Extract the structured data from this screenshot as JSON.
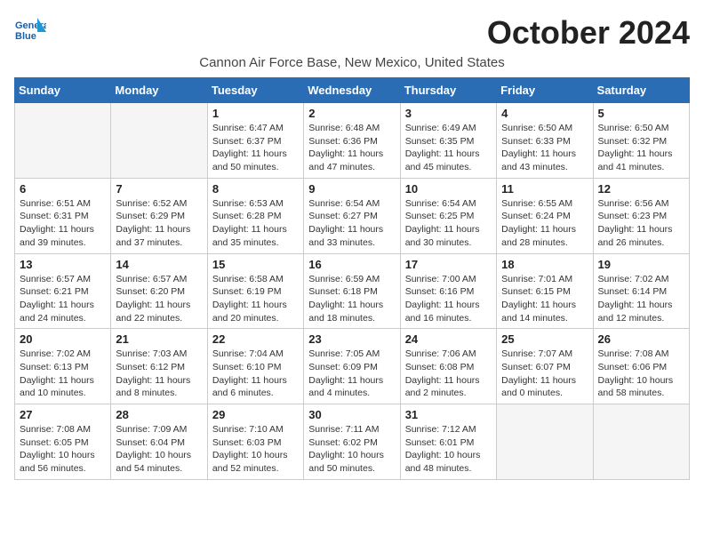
{
  "header": {
    "logo_line1": "General",
    "logo_line2": "Blue",
    "month": "October 2024",
    "location": "Cannon Air Force Base, New Mexico, United States"
  },
  "weekdays": [
    "Sunday",
    "Monday",
    "Tuesday",
    "Wednesday",
    "Thursday",
    "Friday",
    "Saturday"
  ],
  "weeks": [
    [
      {
        "day": "",
        "empty": true
      },
      {
        "day": "",
        "empty": true
      },
      {
        "day": "1",
        "sunrise": "6:47 AM",
        "sunset": "6:37 PM",
        "daylight": "11 hours and 50 minutes."
      },
      {
        "day": "2",
        "sunrise": "6:48 AM",
        "sunset": "6:36 PM",
        "daylight": "11 hours and 47 minutes."
      },
      {
        "day": "3",
        "sunrise": "6:49 AM",
        "sunset": "6:35 PM",
        "daylight": "11 hours and 45 minutes."
      },
      {
        "day": "4",
        "sunrise": "6:50 AM",
        "sunset": "6:33 PM",
        "daylight": "11 hours and 43 minutes."
      },
      {
        "day": "5",
        "sunrise": "6:50 AM",
        "sunset": "6:32 PM",
        "daylight": "11 hours and 41 minutes."
      }
    ],
    [
      {
        "day": "6",
        "sunrise": "6:51 AM",
        "sunset": "6:31 PM",
        "daylight": "11 hours and 39 minutes."
      },
      {
        "day": "7",
        "sunrise": "6:52 AM",
        "sunset": "6:29 PM",
        "daylight": "11 hours and 37 minutes."
      },
      {
        "day": "8",
        "sunrise": "6:53 AM",
        "sunset": "6:28 PM",
        "daylight": "11 hours and 35 minutes."
      },
      {
        "day": "9",
        "sunrise": "6:54 AM",
        "sunset": "6:27 PM",
        "daylight": "11 hours and 33 minutes."
      },
      {
        "day": "10",
        "sunrise": "6:54 AM",
        "sunset": "6:25 PM",
        "daylight": "11 hours and 30 minutes."
      },
      {
        "day": "11",
        "sunrise": "6:55 AM",
        "sunset": "6:24 PM",
        "daylight": "11 hours and 28 minutes."
      },
      {
        "day": "12",
        "sunrise": "6:56 AM",
        "sunset": "6:23 PM",
        "daylight": "11 hours and 26 minutes."
      }
    ],
    [
      {
        "day": "13",
        "sunrise": "6:57 AM",
        "sunset": "6:21 PM",
        "daylight": "11 hours and 24 minutes."
      },
      {
        "day": "14",
        "sunrise": "6:57 AM",
        "sunset": "6:20 PM",
        "daylight": "11 hours and 22 minutes."
      },
      {
        "day": "15",
        "sunrise": "6:58 AM",
        "sunset": "6:19 PM",
        "daylight": "11 hours and 20 minutes."
      },
      {
        "day": "16",
        "sunrise": "6:59 AM",
        "sunset": "6:18 PM",
        "daylight": "11 hours and 18 minutes."
      },
      {
        "day": "17",
        "sunrise": "7:00 AM",
        "sunset": "6:16 PM",
        "daylight": "11 hours and 16 minutes."
      },
      {
        "day": "18",
        "sunrise": "7:01 AM",
        "sunset": "6:15 PM",
        "daylight": "11 hours and 14 minutes."
      },
      {
        "day": "19",
        "sunrise": "7:02 AM",
        "sunset": "6:14 PM",
        "daylight": "11 hours and 12 minutes."
      }
    ],
    [
      {
        "day": "20",
        "sunrise": "7:02 AM",
        "sunset": "6:13 PM",
        "daylight": "11 hours and 10 minutes."
      },
      {
        "day": "21",
        "sunrise": "7:03 AM",
        "sunset": "6:12 PM",
        "daylight": "11 hours and 8 minutes."
      },
      {
        "day": "22",
        "sunrise": "7:04 AM",
        "sunset": "6:10 PM",
        "daylight": "11 hours and 6 minutes."
      },
      {
        "day": "23",
        "sunrise": "7:05 AM",
        "sunset": "6:09 PM",
        "daylight": "11 hours and 4 minutes."
      },
      {
        "day": "24",
        "sunrise": "7:06 AM",
        "sunset": "6:08 PM",
        "daylight": "11 hours and 2 minutes."
      },
      {
        "day": "25",
        "sunrise": "7:07 AM",
        "sunset": "6:07 PM",
        "daylight": "11 hours and 0 minutes."
      },
      {
        "day": "26",
        "sunrise": "7:08 AM",
        "sunset": "6:06 PM",
        "daylight": "10 hours and 58 minutes."
      }
    ],
    [
      {
        "day": "27",
        "sunrise": "7:08 AM",
        "sunset": "6:05 PM",
        "daylight": "10 hours and 56 minutes."
      },
      {
        "day": "28",
        "sunrise": "7:09 AM",
        "sunset": "6:04 PM",
        "daylight": "10 hours and 54 minutes."
      },
      {
        "day": "29",
        "sunrise": "7:10 AM",
        "sunset": "6:03 PM",
        "daylight": "10 hours and 52 minutes."
      },
      {
        "day": "30",
        "sunrise": "7:11 AM",
        "sunset": "6:02 PM",
        "daylight": "10 hours and 50 minutes."
      },
      {
        "day": "31",
        "sunrise": "7:12 AM",
        "sunset": "6:01 PM",
        "daylight": "10 hours and 48 minutes."
      },
      {
        "day": "",
        "empty": true
      },
      {
        "day": "",
        "empty": true
      }
    ]
  ]
}
